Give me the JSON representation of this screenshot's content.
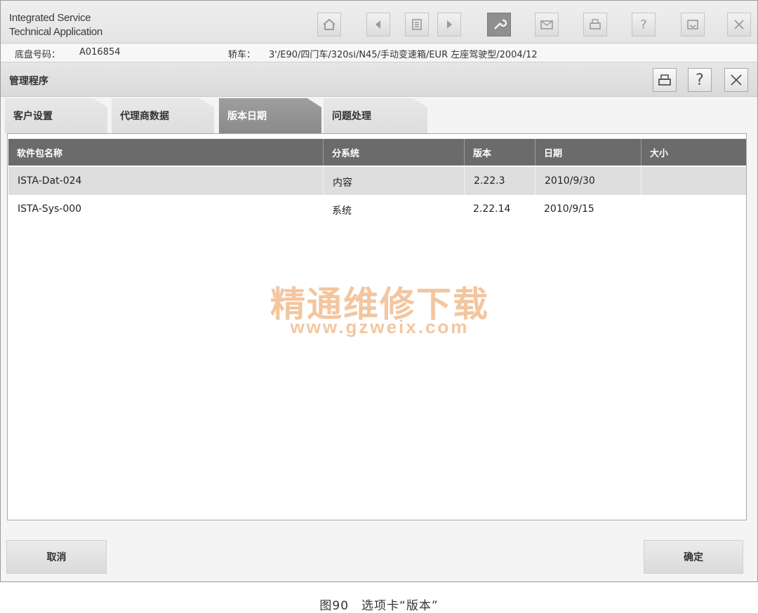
{
  "app": {
    "title_line1": "Integrated Service",
    "title_line2": "Technical Application"
  },
  "toolbar": {
    "help_label": "?"
  },
  "vehicle": {
    "chassis_label": "底盘号码：",
    "chassis_value": "A016854",
    "model_label": "轿车：",
    "model_value": "3'/E90/四门车/320si/N45/手动变速箱/EUR 左座驾驶型/2004/12"
  },
  "dialog": {
    "title": "管理程序",
    "help_label": "?"
  },
  "tabs": [
    {
      "label": "客户设置"
    },
    {
      "label": "代理商数据"
    },
    {
      "label": "版本日期"
    },
    {
      "label": "问题处理"
    }
  ],
  "table": {
    "columns": [
      "软件包名称",
      "分系统",
      "版本",
      "日期",
      "大小"
    ],
    "rows": [
      {
        "name": "ISTA-Dat-024",
        "subsystem": "内容",
        "version": "2.22.3",
        "date": "2010/9/30",
        "size": ""
      },
      {
        "name": "ISTA-Sys-000",
        "subsystem": "系统",
        "version": "2.22.14",
        "date": "2010/9/15",
        "size": ""
      }
    ]
  },
  "watermark": {
    "text": "精通维修下载",
    "url": "www.gzweix.com"
  },
  "buttons": {
    "cancel": "取消",
    "ok": "确定"
  },
  "caption": "图90　选项卡“版本”"
}
